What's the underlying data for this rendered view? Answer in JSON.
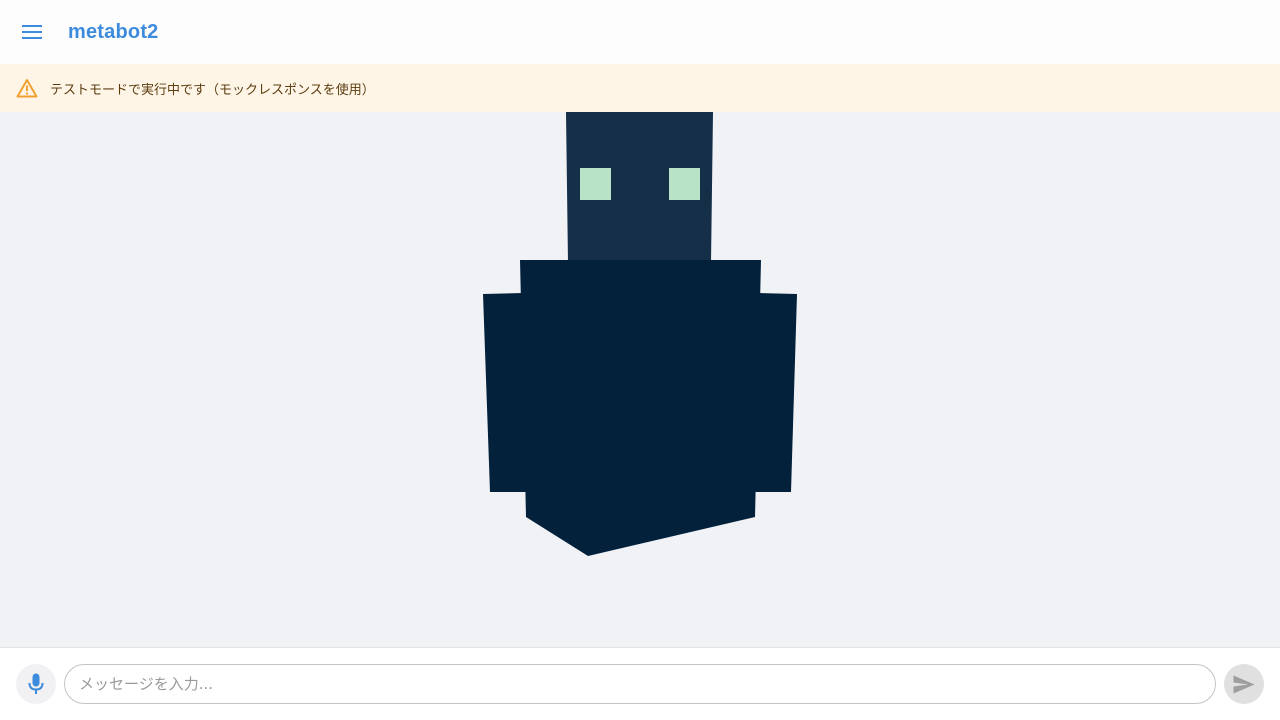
{
  "header": {
    "title": "metabot2",
    "menu_icon": "hamburger-menu-icon",
    "accent_color": "#3d8bdc"
  },
  "banner": {
    "text": "テストモードで実行中です（モックレスポンスを使用）",
    "icon": "warning-triangle-icon",
    "background": "#fff5e6",
    "icon_color": "#f0a030"
  },
  "scene": {
    "background": "#f0f2f6",
    "robot": {
      "head_color": "#142f47",
      "body_color": "#03213b",
      "eye_color": "#b9e3c6"
    }
  },
  "input": {
    "placeholder": "メッセージを入力...",
    "value": "",
    "mic_icon": "microphone-icon",
    "send_icon": "send-icon"
  }
}
